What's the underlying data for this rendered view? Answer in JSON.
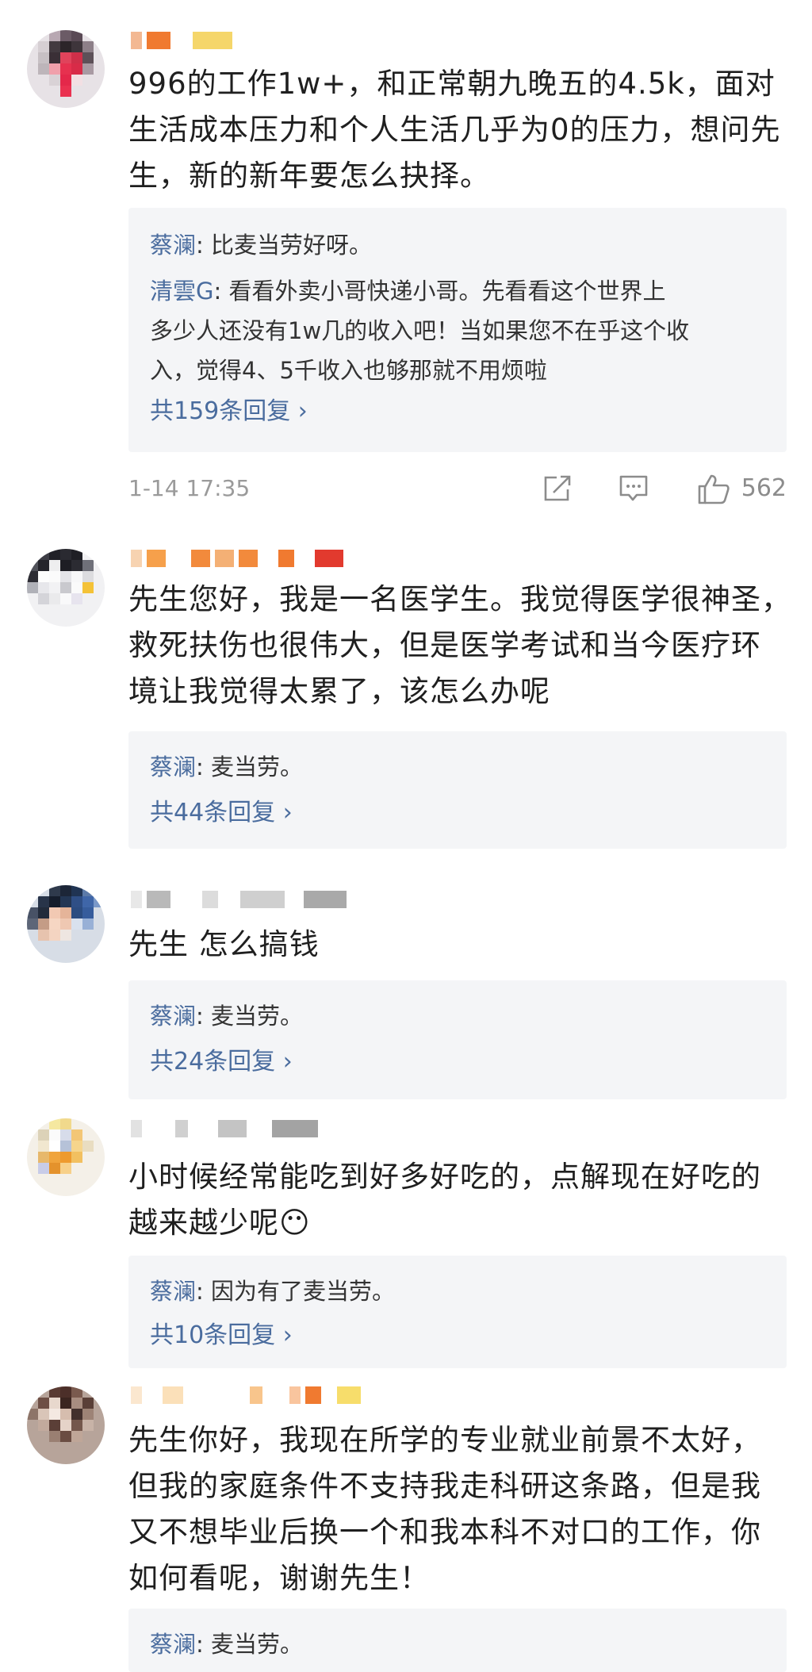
{
  "colors": {
    "link": "#4a6c9e",
    "reply_bg": "#f4f5f7",
    "meta": "#9a9a9a"
  },
  "comments": [
    {
      "text_lines": [
        "996的工作1w+，和正常朝九晚五的4.5k，面对",
        "生活成本压力和个人生活几乎为0的压力，想问先",
        "生，新的新年要怎么抉择。"
      ],
      "replies": [
        {
          "name": "蔡澜",
          "lines": [
            ": 比麦当劳好呀。"
          ]
        },
        {
          "name": "清雲G",
          "lines": [
            ": 看看外卖小哥快递小哥。先看看这个世界上",
            "多少人还没有1w几的收入吧！当如果您不在乎这个收",
            "入，觉得4、5千收入也够那就不用烦啦"
          ]
        }
      ],
      "more": "共159条回复 ›",
      "time": "1-14 17:35",
      "likes": "562",
      "icons": [
        "share-icon",
        "comment-icon",
        "like-icon"
      ]
    },
    {
      "text_lines": [
        "先生您好，我是一名医学生。我觉得医学很神圣，",
        "救死扶伤也很伟大，但是医学考试和当今医疗环",
        "境让我觉得太累了，该怎么办呢"
      ],
      "replies": [
        {
          "name": "蔡澜",
          "lines": [
            ": 麦当劳。"
          ]
        }
      ],
      "more": "共44条回复 ›"
    },
    {
      "text_lines": [
        "先生 怎么搞钱"
      ],
      "replies": [
        {
          "name": "蔡澜",
          "lines": [
            ": 麦当劳。"
          ]
        }
      ],
      "more": "共24条回复 ›"
    },
    {
      "text_lines": [
        "小时候经常能吃到好多好吃的，点解现在好吃的",
        "越来越少呢😶"
      ],
      "replies": [
        {
          "name": "蔡澜",
          "lines": [
            ": 因为有了麦当劳。"
          ]
        }
      ],
      "more": "共10条回复 ›"
    },
    {
      "text_lines": [
        "先生你好，我现在所学的专业就业前景不太好，",
        "但我的家庭条件不支持我走科研这条路，但是我",
        "又不想毕业后换一个和我本科不对口的工作，你",
        "如何看呢，谢谢先生！"
      ],
      "replies": [
        {
          "name": "蔡澜",
          "lines": [
            ": 麦当劳。"
          ]
        }
      ]
    }
  ]
}
